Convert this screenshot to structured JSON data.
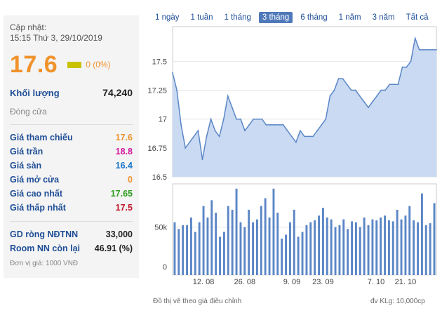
{
  "quote": {
    "update_label": "Cập nhật:",
    "update_time": "15:15 Thứ 3, 29/10/2019",
    "price": "17.6",
    "change": "0 (0%)",
    "volume_label": "Khối lượng",
    "volume": "74,240",
    "close_label": "Đóng cửa",
    "rows": [
      {
        "label": "Giá tham chiếu",
        "value": "17.6",
        "color": "#f0922b"
      },
      {
        "label": "Giá trần",
        "value": "18.8",
        "color": "#d4169f"
      },
      {
        "label": "Giá sàn",
        "value": "16.4",
        "color": "#1b76c9"
      },
      {
        "label": "Giá mở cửa",
        "value": "0",
        "color": "#f0922b"
      },
      {
        "label": "Giá cao nhất",
        "value": "17.65",
        "color": "#2e9e1f"
      },
      {
        "label": "Giá thấp nhất",
        "value": "17.5",
        "color": "#c0152b"
      }
    ],
    "foreign": [
      {
        "label": "GD ròng NĐTNN",
        "value": "33,000"
      },
      {
        "label": "Room NN còn lại",
        "value": "46.91 (%)"
      }
    ],
    "unit_note": "Đơn vị giá: 1000 VNĐ"
  },
  "ranges": [
    "1 ngày",
    "1 tuần",
    "1 tháng",
    "3 tháng",
    "6 tháng",
    "1 năm",
    "3 năm",
    "Tất cả"
  ],
  "active_range": "3 tháng",
  "footnotes": {
    "left": "Đồ thị vẽ theo giá điều chỉnh",
    "right": "đv KLg: 10,000cp"
  },
  "colors": {
    "line": "#5b86c6",
    "area": "#c9daf2",
    "bar": "#5b86c6"
  },
  "chart_data": [
    {
      "type": "area",
      "x": [
        "01.08",
        "02.08",
        "05.08",
        "06.08",
        "07.08",
        "08.08",
        "09.08",
        "12.08",
        "13.08",
        "14.08",
        "15.08",
        "16.08",
        "19.08",
        "20.08",
        "21.08",
        "22.08",
        "23.08",
        "26.08",
        "27.08",
        "28.08",
        "29.08",
        "30.08",
        "03.09",
        "04.09",
        "05.09",
        "06.09",
        "09.09",
        "10.09",
        "11.09",
        "12.09",
        "13.09",
        "16.09",
        "17.09",
        "18.09",
        "19.09",
        "20.09",
        "23.09",
        "24.09",
        "25.09",
        "26.09",
        "27.09",
        "30.09",
        "01.10",
        "02.10",
        "03.10",
        "04.10",
        "07.10",
        "08.10",
        "09.10",
        "10.10",
        "11.10",
        "14.10",
        "15.10",
        "16.10",
        "17.10",
        "18.10",
        "21.10",
        "22.10",
        "23.10",
        "24.10",
        "25.10",
        "28.10",
        "29.10"
      ],
      "y": [
        17.4,
        17.25,
        16.95,
        16.75,
        16.8,
        16.85,
        16.9,
        16.65,
        16.85,
        17.0,
        16.9,
        16.85,
        17.0,
        17.2,
        17.1,
        17.0,
        17.0,
        16.9,
        16.95,
        17.0,
        17.0,
        17.0,
        16.95,
        16.95,
        16.95,
        16.95,
        16.95,
        16.9,
        16.85,
        16.8,
        16.9,
        16.85,
        16.85,
        16.85,
        16.9,
        16.95,
        17.0,
        17.2,
        17.25,
        17.35,
        17.35,
        17.3,
        17.25,
        17.25,
        17.2,
        17.15,
        17.1,
        17.15,
        17.2,
        17.25,
        17.25,
        17.3,
        17.3,
        17.3,
        17.45,
        17.45,
        17.5,
        17.7,
        17.6,
        17.6,
        17.6,
        17.6,
        17.6
      ],
      "yticks": [
        16.5,
        16.75,
        17,
        17.25,
        17.5
      ],
      "ytick_labels": [
        "16.5",
        "16.75",
        "17",
        "17.25",
        "17.5"
      ],
      "ylim": [
        16.5,
        17.8
      ]
    },
    {
      "type": "bar",
      "x": [
        "01.08",
        "02.08",
        "05.08",
        "06.08",
        "07.08",
        "08.08",
        "09.08",
        "12.08",
        "13.08",
        "14.08",
        "15.08",
        "16.08",
        "19.08",
        "20.08",
        "21.08",
        "22.08",
        "23.08",
        "26.08",
        "27.08",
        "28.08",
        "29.08",
        "30.08",
        "03.09",
        "04.09",
        "05.09",
        "06.09",
        "09.09",
        "10.09",
        "11.09",
        "12.09",
        "13.09",
        "16.09",
        "17.09",
        "18.09",
        "19.09",
        "20.09",
        "23.09",
        "24.09",
        "25.09",
        "26.09",
        "27.09",
        "30.09",
        "01.10",
        "02.10",
        "03.10",
        "04.10",
        "07.10",
        "08.10",
        "09.10",
        "10.10",
        "11.10",
        "14.10",
        "15.10",
        "16.10",
        "17.10",
        "18.10",
        "21.10",
        "22.10",
        "23.10",
        "24.10",
        "25.10",
        "28.10",
        "29.10"
      ],
      "values": [
        55,
        48,
        52,
        52,
        60,
        45,
        55,
        72,
        60,
        78,
        65,
        40,
        45,
        72,
        68,
        90,
        55,
        50,
        68,
        55,
        58,
        72,
        80,
        60,
        90,
        65,
        38,
        42,
        55,
        68,
        40,
        45,
        52,
        55,
        57,
        62,
        70,
        60,
        58,
        50,
        52,
        58,
        48,
        56,
        55,
        50,
        60,
        52,
        58,
        57,
        60,
        62,
        57,
        56,
        68,
        58,
        62,
        72,
        57,
        55,
        85,
        52,
        54,
        75
      ],
      "bar_labels_shown": true,
      "yticks": [
        0,
        50
      ],
      "ytick_labels": [
        "0",
        "50k"
      ],
      "ylim": [
        0,
        95
      ],
      "xticks": [
        "12. 08",
        "26. 08",
        "9. 09",
        "23. 09",
        "7. 10",
        "21. 10"
      ]
    }
  ]
}
